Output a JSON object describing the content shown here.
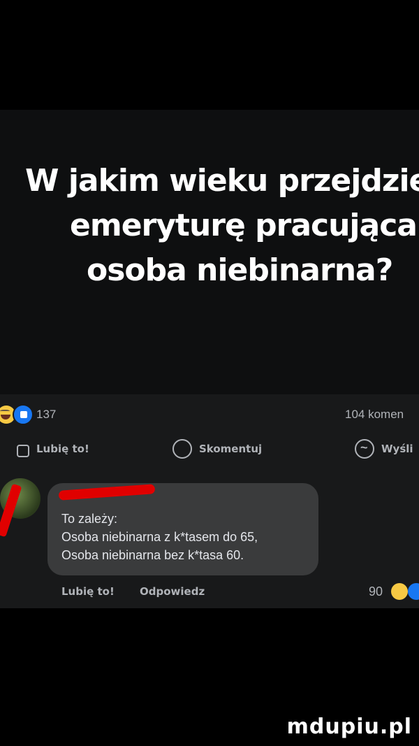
{
  "post": {
    "text_lines": [
      "W jakim wieku przejdzie na",
      "emeryturę pracująca",
      "osoba niebinarna?"
    ]
  },
  "reactions": {
    "count": "137",
    "comments": "104 komen"
  },
  "actions": {
    "like": "Lubię to!",
    "comment": "Skomentuj",
    "send": "Wyśli"
  },
  "comment": {
    "text": [
      "To zależy:",
      "Osoba niebinarna z k*tasem do 65,",
      "Osoba niebinarna  bez k*tasa 60."
    ],
    "like": "Lubię to!",
    "reply": "Odpowiedz",
    "reaction_count": "90"
  },
  "watermark": "mdupiu.pl",
  "colors": {
    "background": "#000000",
    "post_bg": "#18191a",
    "bubble": "#3a3b3c",
    "redaction": "#e00000"
  }
}
